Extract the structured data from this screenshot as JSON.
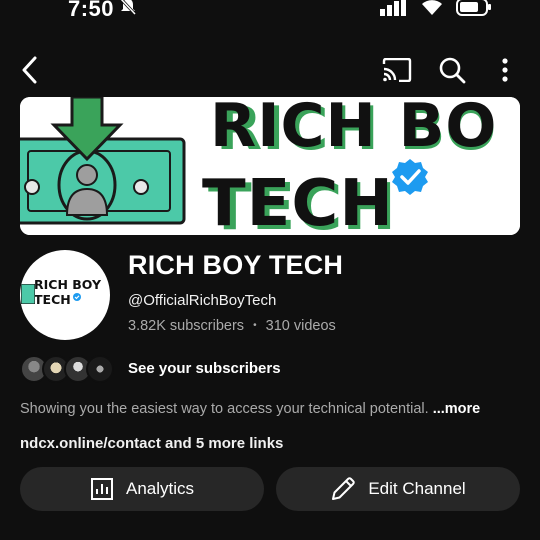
{
  "status": {
    "time": "7:50",
    "icons": [
      "bell-off-icon",
      "signal-icon",
      "wifi-icon",
      "battery-icon"
    ]
  },
  "topbar": {
    "icons": [
      "back-icon",
      "cast-icon",
      "search-icon",
      "more-vertical-icon"
    ]
  },
  "banner": {
    "line1": "RICH BO",
    "line2": "TECH",
    "verified_icon": "verified-badge-icon"
  },
  "channel": {
    "avatar_line1": "RICH BOY",
    "avatar_line2": "TECH",
    "name": "RICH BOY TECH",
    "handle": "@OfficialRichBoyTech",
    "subscribers": "3.82K subscribers",
    "separator": "•",
    "videos": "310 videos"
  },
  "subscribers_row": {
    "label": "See your subscribers"
  },
  "description": {
    "text": "Showing you the easiest way to access your technical potential.",
    "more": "...more"
  },
  "links": {
    "text": "ndcx.online/contact and 5 more links"
  },
  "actions": {
    "analytics_label": "Analytics",
    "edit_label": "Edit Channel"
  },
  "colors": {
    "background": "#0f0f0f",
    "button": "#272727",
    "banner_green": "#3aa35a",
    "banner_teal": "#4cc9a8",
    "verified_blue": "#1d9bf0"
  }
}
